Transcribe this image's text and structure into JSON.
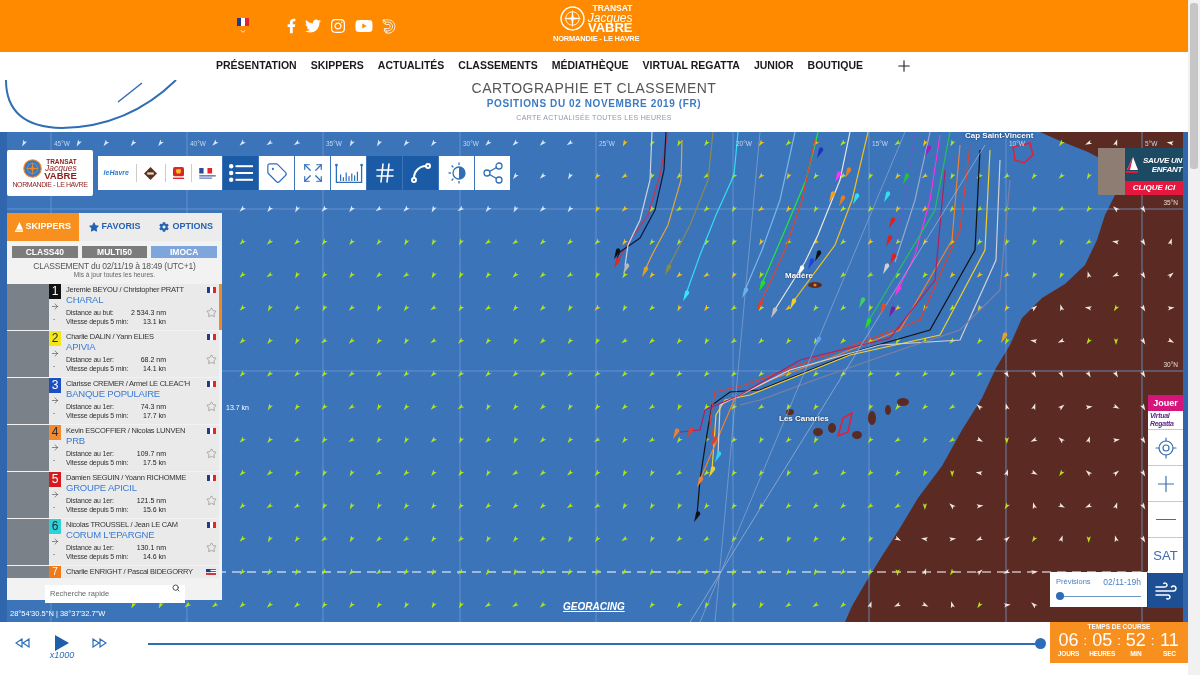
{
  "header": {
    "logo": {
      "line1": "TRANSAT",
      "line2": "Jacques",
      "line3": "VABRE",
      "tagline": "NORMANDIE - LE HAVRE"
    }
  },
  "nav": {
    "items": [
      "PRÉSENTATION",
      "SKIPPERS",
      "ACTUALITÉS",
      "CLASSEMENTS",
      "MÉDIATHÈQUE",
      "VIRTUAL REGATTA",
      "JUNIOR",
      "BOUTIQUE"
    ]
  },
  "page": {
    "title": "CARTOGRAPHIE ET CLASSEMENT",
    "subtitle": "POSITIONS DU 02 NOVEMBRE 2019 (FR)",
    "note": "CARTE ACTUALISÉE TOUTES LES HEURES"
  },
  "map": {
    "logo": {
      "line1": "TRANSAT",
      "line2": "Jacques",
      "line3": "VABRE",
      "tagline": "NORMANDIE - LE HAVRE"
    },
    "partner_text": "leHavre",
    "tools": [
      {
        "kind": "list",
        "selected": true
      },
      {
        "kind": "tag",
        "selected": false
      },
      {
        "kind": "expand",
        "selected": false
      },
      {
        "kind": "chart",
        "selected": false
      },
      {
        "kind": "grid",
        "selected": true
      },
      {
        "kind": "route",
        "selected": true
      },
      {
        "kind": "contrast",
        "selected": false
      },
      {
        "kind": "share",
        "selected": false
      }
    ],
    "longitudes": [
      "45°W",
      "40°W",
      "35°W",
      "30°W",
      "25°W",
      "20°W",
      "15°W",
      "10°W",
      "5°W"
    ],
    "latitudes": [
      "35°N",
      "30°N"
    ],
    "places": [
      "Cap Saint-Vincent",
      "Madère",
      "Les Canaries"
    ],
    "speed_tag": "13.7 kn",
    "credit": "GEORACING",
    "cursor_position": "28°54'30.5\"N | 38°37'32.7\"W",
    "ad": {
      "line1": "SAUVE UN",
      "line2": "ENFANT",
      "cta": "CLIQUE ICI"
    },
    "play": {
      "label": "Jouer",
      "logo_line1": "Virtual",
      "logo_line2": "Regatta"
    },
    "sat_label": "SAT",
    "forecast": {
      "label": "Prévisions",
      "time": "02/11-19h",
      "level": 0
    }
  },
  "ranking_panel": {
    "tabs": [
      {
        "label": "SKIPPERS",
        "selected": true
      },
      {
        "label": "FAVORIS",
        "selected": false
      },
      {
        "label": "OPTIONS",
        "selected": false
      }
    ],
    "classes": [
      {
        "label": "CLASS40",
        "selected": false
      },
      {
        "label": "MULTI50",
        "selected": false
      },
      {
        "label": "IMOCA",
        "selected": true
      }
    ],
    "title": "CLASSEMENT du 02/11/19 à 18:49 (UTC+1)",
    "note": "Mis à jour toutes les heures.",
    "entries": [
      {
        "rank": "1",
        "color": "#111111",
        "skippers": "Jeremie BEYOU / Christopher PRATT",
        "boat": "CHARAL",
        "trend": "-",
        "distance_label": "Distance au but:",
        "distance": "2 534.3 nm",
        "speed_label": "Vitesse depuis 5 min:",
        "speed": "13.1 kn",
        "flag": {
          "kind": "fr"
        },
        "favorite": false,
        "selected": true
      },
      {
        "rank": "2",
        "color": "#f3e61a",
        "skippers": "Charlie DALIN / Yann ELIES",
        "boat": "APIVIA",
        "trend": "-",
        "distance_label": "Distance au 1er:",
        "distance": "68.2 nm",
        "speed_label": "Vitesse depuis 5 min:",
        "speed": "14.1 kn",
        "flag": {
          "kind": "fr"
        },
        "favorite": false,
        "selected": false
      },
      {
        "rank": "3",
        "color": "#1b4fc4",
        "skippers": "Clarisse CREMER / Armel LE CLEAC'H",
        "boat": "BANQUE POPULAIRE",
        "trend": "-",
        "distance_label": "Distance au 1er:",
        "distance": "74.3 nm",
        "speed_label": "Vitesse depuis 5 min:",
        "speed": "17.7 kn",
        "flag": {
          "kind": "fr"
        },
        "favorite": false,
        "selected": false
      },
      {
        "rank": "4",
        "color": "#f28a30",
        "skippers": "Kevin ESCOFFIER / Nicolas LUNVEN",
        "boat": "PRB",
        "trend": "-",
        "distance_label": "Distance au 1er:",
        "distance": "109.7 nm",
        "speed_label": "Vitesse depuis 5 min:",
        "speed": "17.5 kn",
        "flag": {
          "kind": "fr"
        },
        "favorite": false,
        "selected": false
      },
      {
        "rank": "5",
        "color": "#d71920",
        "skippers": "Damien SEGUIN / Yoann RICHOMME",
        "boat": "GROUPE APICIL",
        "trend": "-",
        "distance_label": "Distance au 1er:",
        "distance": "121.5 nm",
        "speed_label": "Vitesse depuis 5 min:",
        "speed": "15.6 kn",
        "flag": {
          "kind": "fr"
        },
        "favorite": false,
        "selected": false
      },
      {
        "rank": "6",
        "color": "#2ed3d3",
        "skippers": "Nicolas TROUSSEL / Jean LE CAM",
        "boat": "CORUM L'EPARGNE",
        "trend": "-",
        "distance_label": "Distance au 1er:",
        "distance": "130.1 nm",
        "speed_label": "Vitesse depuis 5 min:",
        "speed": "14.6 kn",
        "flag": {
          "kind": "fr"
        },
        "favorite": false,
        "selected": false
      },
      {
        "rank": "7",
        "color": "#f07a1a",
        "skippers": "Charlie ENRIGHT / Pascal BIDEGORRY",
        "flag": {
          "kind": "us"
        },
        "selected": false
      }
    ],
    "search": {
      "placeholder": "Recherche rapide"
    }
  },
  "playback": {
    "speed": "x1000",
    "level": 1,
    "race_time": {
      "title": "TEMPS DE COURSE",
      "separator": ":",
      "parts": [
        {
          "value": "06",
          "unit": "JOURS"
        },
        {
          "value": "05",
          "unit": "HEURES"
        },
        {
          "value": "52",
          "unit": "MIN"
        },
        {
          "value": "11",
          "unit": "SEC"
        }
      ]
    }
  }
}
